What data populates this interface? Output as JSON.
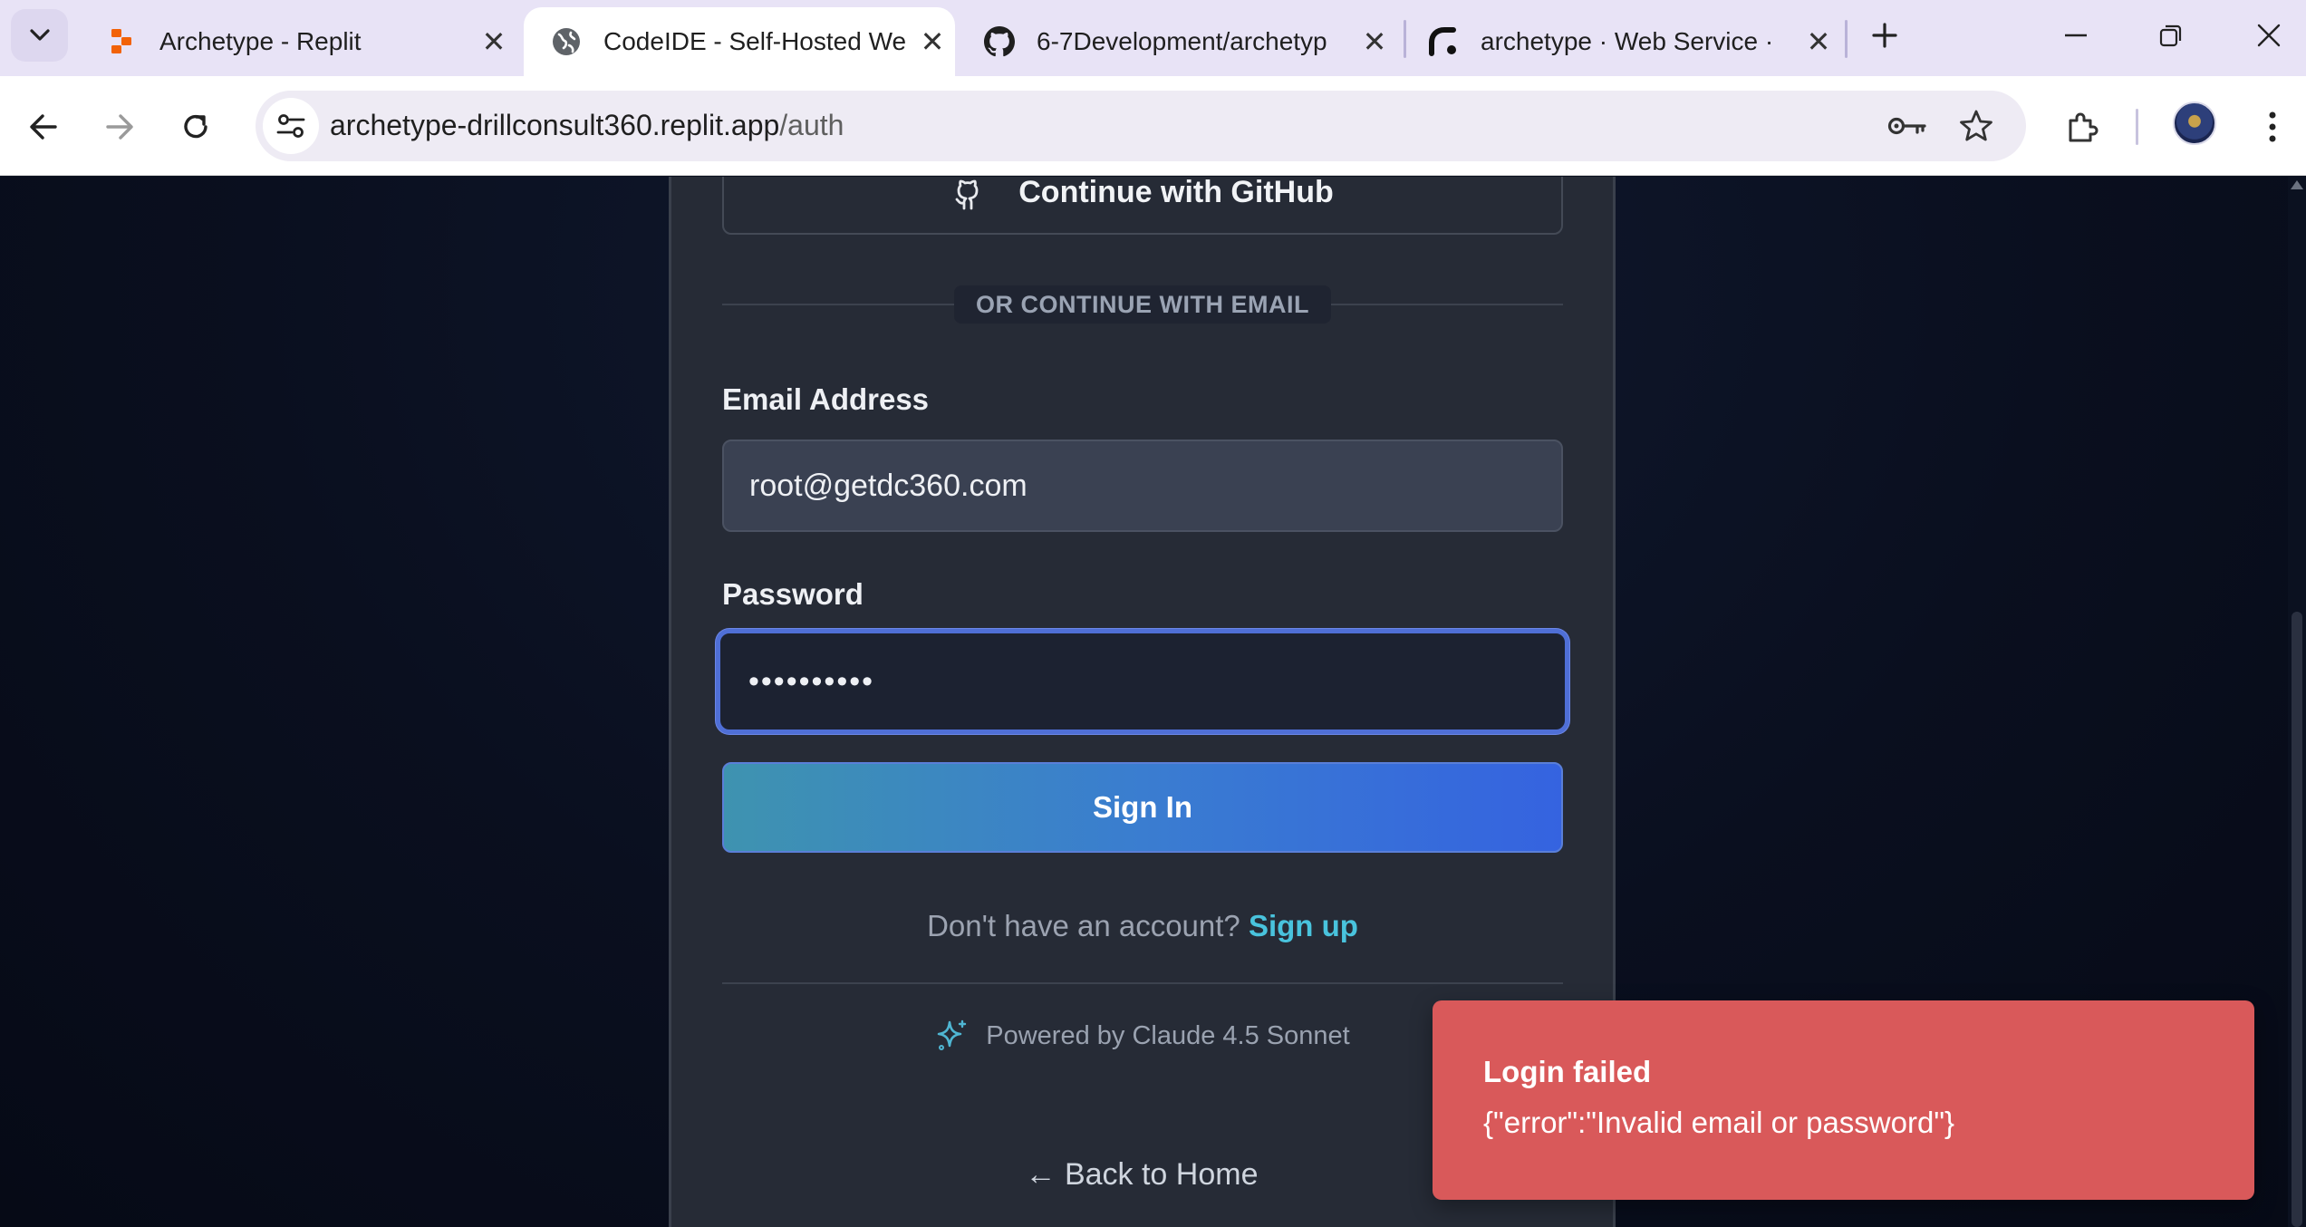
{
  "browser": {
    "tabs": [
      {
        "title": "Archetype - Replit",
        "icon": "replit-icon",
        "active": false
      },
      {
        "title": "CodeIDE - Self-Hosted We",
        "icon": "globe-icon",
        "active": true
      },
      {
        "title": "6-7Development/archetyp",
        "icon": "github-icon",
        "active": false
      },
      {
        "title": "archetype · Web Service ·",
        "icon": "render-icon",
        "active": false
      }
    ],
    "url_host": "archetype-drillconsult360.replit.app",
    "url_path": "/auth"
  },
  "auth": {
    "github_button": "Continue with GitHub",
    "divider": "OR CONTINUE WITH EMAIL",
    "email_label": "Email Address",
    "email_value": "root@getdc360.com",
    "password_label": "Password",
    "password_value": "••••••••••",
    "sign_in": "Sign In",
    "no_account": "Don't have an account?",
    "sign_up": "Sign up",
    "powered_by": "Powered by Claude 4.5 Sonnet",
    "back_home": "← Back to Home"
  },
  "toast": {
    "title": "Login failed",
    "message": "{\"error\":\"Invalid email or password\"}",
    "color": "#d9595a"
  },
  "colors": {
    "accent": "#3a7dd0",
    "link": "#49c3dd"
  }
}
